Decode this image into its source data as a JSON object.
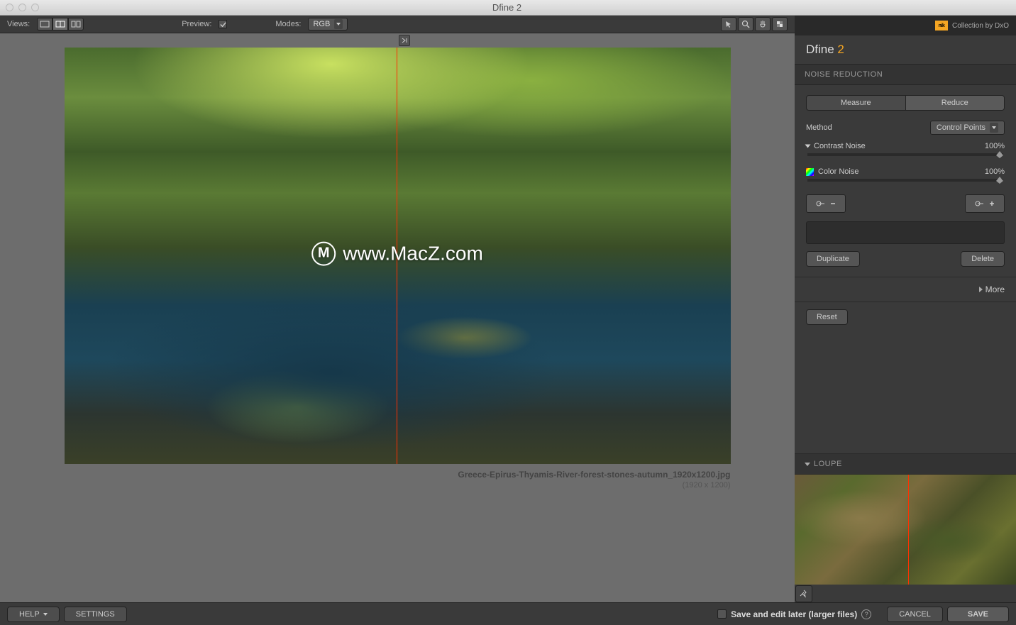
{
  "window": {
    "title": "Dfine 2"
  },
  "toolbar": {
    "views_label": "Views:",
    "preview_label": "Preview:",
    "modes_label": "Modes:",
    "mode_value": "RGB"
  },
  "image": {
    "watermark": "www.MacZ.com",
    "filename": "Greece-Epirus-Thyamis-River-forest-stones-autumn_1920x1200.jpg",
    "dimensions": "(1920 x 1200)"
  },
  "brand": {
    "collection": "Collection by DxO",
    "nik": "nik"
  },
  "panel": {
    "app_name": "Dfine ",
    "app_version": "2",
    "section": "NOISE REDUCTION",
    "tab_measure": "Measure",
    "tab_reduce": "Reduce",
    "method_label": "Method",
    "method_value": "Control Points",
    "contrast_label": "Contrast Noise",
    "contrast_value": "100%",
    "color_label": "Color Noise",
    "color_value": "100%",
    "duplicate": "Duplicate",
    "delete": "Delete",
    "more": "More",
    "reset": "Reset",
    "loupe": "LOUPE"
  },
  "footer": {
    "help": "HELP",
    "settings": "SETTINGS",
    "save_later": "Save and edit later (larger files)",
    "cancel": "CANCEL",
    "save": "SAVE"
  }
}
